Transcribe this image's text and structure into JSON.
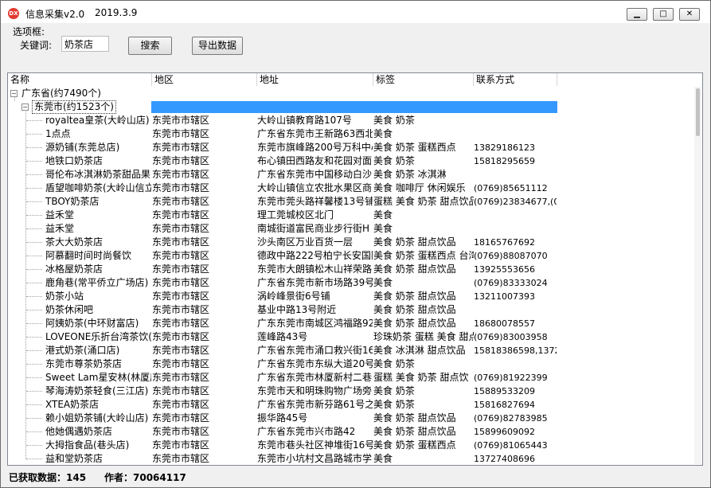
{
  "window": {
    "title": "信息采集v2.0",
    "date": "2019.3.9",
    "icon_text": "DX"
  },
  "options": {
    "label": "选项框:",
    "keyword_label": "关键词:",
    "keyword_value": "奶茶店",
    "search_button": "搜索",
    "export_button": "导出数据"
  },
  "table": {
    "columns": [
      "名称",
      "地区",
      "地址",
      "标签",
      "联系方式"
    ],
    "root": {
      "label": "广东省(约7490个)"
    },
    "city": {
      "label": "东莞市(约1523个)"
    },
    "rows": [
      {
        "name": "royaltea皇茶(大岭山店)",
        "area": "东莞市市辖区",
        "address": "大岭山镇教育路107号",
        "tag": "美食 奶茶",
        "phone": ""
      },
      {
        "name": "1点点",
        "area": "东莞市市辖区",
        "address": "广东省东莞市王新路63西北",
        "tag": "美食",
        "phone": ""
      },
      {
        "name": "源奶铺(东莞总店)",
        "area": "东莞市市辖区",
        "address": "东莞市旗峰路200号万科中心",
        "tag": "美食 奶茶 蛋糕西点",
        "phone": "13829186123"
      },
      {
        "name": "地铁口奶茶店",
        "area": "东莞市市辖区",
        "address": "布心镇田西路友和花园对面",
        "tag": "美食 奶茶",
        "phone": "15818295659"
      },
      {
        "name": "哥伦布冰淇淋奶茶甜品果",
        "area": "东莞市市辖区",
        "address": "广东省东莞市中国移动白沙",
        "tag": "美食 奶茶 冰淇淋",
        "phone": ""
      },
      {
        "name": "盾望咖啡奶茶(大岭山信立",
        "area": "东莞市市辖区",
        "address": "大岭山镇信立农批水果区商",
        "tag": "美食 咖啡厅 休闲娱乐",
        "phone": "(0769)85651112"
      },
      {
        "name": "TBOY奶茶店",
        "area": "东莞市市辖区",
        "address": "东莞市莞头路祥馨楼13号铺",
        "tag": "蛋糕 美食 奶茶 甜点饮品",
        "phone": "(0769)23834677,(0769)"
      },
      {
        "name": "益禾堂",
        "area": "东莞市市辖区",
        "address": "理工莞城校区北门",
        "tag": "美食",
        "phone": ""
      },
      {
        "name": "益禾堂",
        "area": "东莞市市辖区",
        "address": "南城街道富民商业步行街H",
        "tag": "美食",
        "phone": ""
      },
      {
        "name": "茶大大奶茶店",
        "area": "东莞市市辖区",
        "address": "沙头南区万业百货一层",
        "tag": "美食 奶茶 甜点饮品",
        "phone": "18165767692"
      },
      {
        "name": "阿慕翻时间时尚餐饮",
        "area": "东莞市市辖区",
        "address": "德政中路222号柏宁长安国际",
        "tag": "美食 奶茶 蛋糕西点 台湾",
        "phone": "(0769)88087070"
      },
      {
        "name": "冰格屋奶茶店",
        "area": "东莞市市辖区",
        "address": "东莞市大朗镇松木山祥荣路",
        "tag": "美食 奶茶 甜点饮品",
        "phone": "13925553656"
      },
      {
        "name": "鹿角巷(常平侨立广场店)",
        "area": "东莞市市辖区",
        "address": "广东省东莞市新市场路39号",
        "tag": "美食",
        "phone": "(0769)83333024"
      },
      {
        "name": "奶茶小站",
        "area": "东莞市市辖区",
        "address": "涡岭峰景街6号铺",
        "tag": "美食 奶茶 甜点饮品",
        "phone": "13211007393"
      },
      {
        "name": "奶茶休闲吧",
        "area": "东莞市市辖区",
        "address": "基业中路13号附近",
        "tag": "美食 奶茶 甜点饮品",
        "phone": ""
      },
      {
        "name": "阿姨奶茶(中环财富店)",
        "area": "东莞市市辖区",
        "address": "广东东莞市南城区鸿福路92",
        "tag": "美食 奶茶 甜点饮品",
        "phone": "18680078557"
      },
      {
        "name": "LOVEONE乐折台湾茶饮(厦",
        "area": "东莞市市辖区",
        "address": "莲峰路43号",
        "tag": "珍珠奶茶 蛋糕 美食 甜点",
        "phone": "(0769)83003958"
      },
      {
        "name": "港式奶茶(涌口店)",
        "area": "东莞市市辖区",
        "address": "广东省东莞市涌口救兴街16",
        "tag": "美食 冰淇淋 甜点饮品",
        "phone": "15818386598,13729"
      },
      {
        "name": "东莞市尊茶奶茶店",
        "area": "东莞市市辖区",
        "address": "广东省东莞市东纵大道20号",
        "tag": "美食 奶茶",
        "phone": ""
      },
      {
        "name": "Sweet Lam星安林(林厦店)",
        "area": "东莞市市辖区",
        "address": "广东省东莞市林厦新村二巷",
        "tag": "蛋糕 美食 奶茶 甜点饮",
        "phone": "(0769)81922399"
      },
      {
        "name": "琴海涛奶茶轻食(三江店)",
        "area": "东莞市市辖区",
        "address": "东莞市天和明珠购物广场旁",
        "tag": "美食 奶茶",
        "phone": "15889533209"
      },
      {
        "name": "XTEA奶茶店",
        "area": "东莞市市辖区",
        "address": "广东省东莞市新芬路61号之",
        "tag": "美食 奶茶",
        "phone": "15816827694"
      },
      {
        "name": "赖小姐奶茶铺(大岭山店)",
        "area": "东莞市市辖区",
        "address": "振华路45号",
        "tag": "美食 奶茶 甜点饮品",
        "phone": "(0769)82783985"
      },
      {
        "name": "他她偶遇奶茶店",
        "area": "东莞市市辖区",
        "address": "广东省东莞市兴市路42",
        "tag": "美食 奶茶 甜点饮品",
        "phone": "15899609092"
      },
      {
        "name": "大拇指食品(巷头店)",
        "area": "东莞市市辖区",
        "address": "东莞市巷头社区神堆街16号",
        "tag": "美食 奶茶 蛋糕西点",
        "phone": "(0769)81065443"
      },
      {
        "name": "益和堂奶茶店",
        "area": "东莞市市辖区",
        "address": "东莞市小坑村文昌路城市学",
        "tag": "美食",
        "phone": "13727408696"
      }
    ]
  },
  "status": {
    "count_text": "已获取数据：145",
    "author_text": "作者：70064117"
  }
}
